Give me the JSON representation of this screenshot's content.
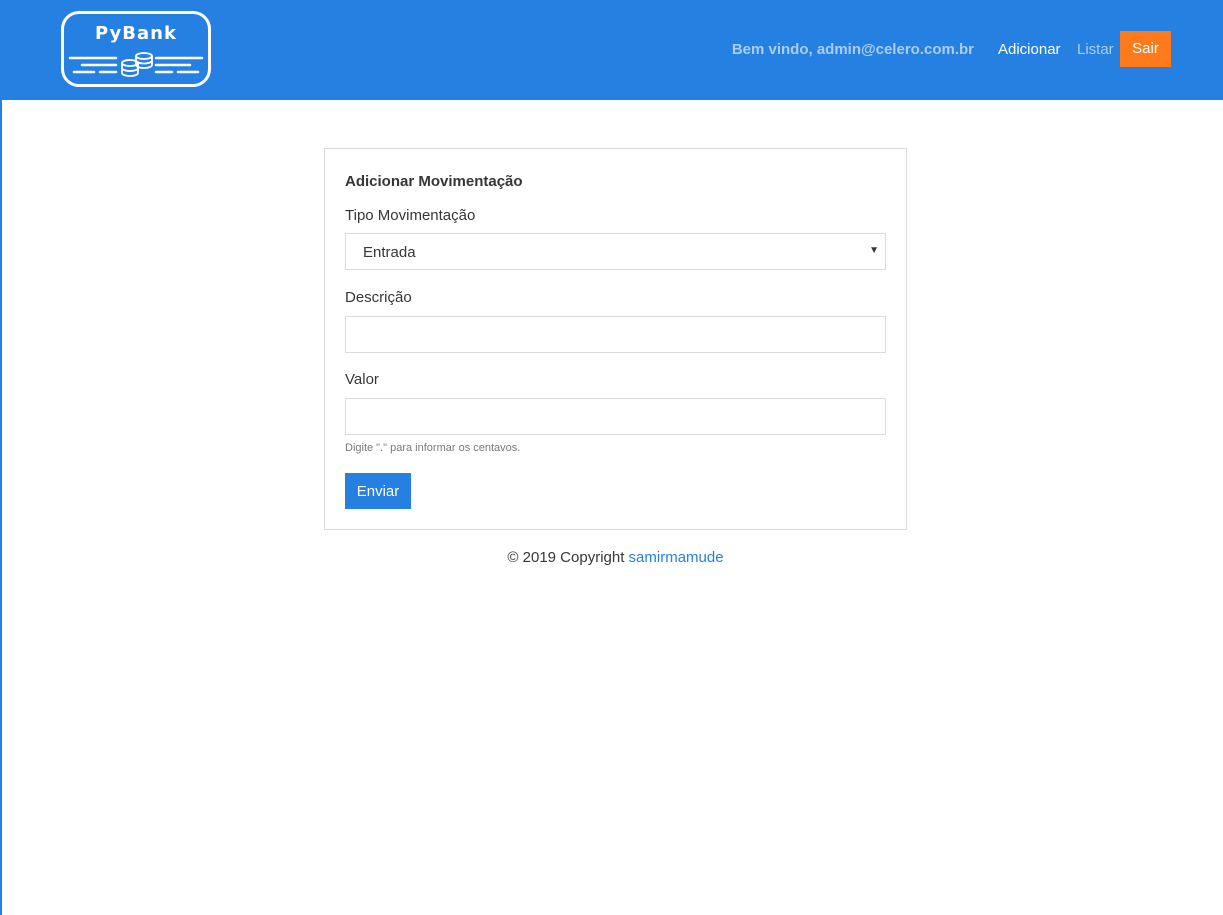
{
  "header": {
    "logo_text": "PyBank",
    "welcome": "Bem vindo, admin@celero.com.br",
    "nav_add": "Adicionar",
    "nav_list": "Listar",
    "logout": "Sair"
  },
  "form": {
    "title": "Adicionar Movimentação",
    "type_label": "Tipo Movimentação",
    "type_selected": "Entrada",
    "description_label": "Descrição",
    "description_value": "",
    "value_label": "Valor",
    "value_value": "",
    "value_help": "Digite \".\" para informar os centavos.",
    "submit": "Enviar"
  },
  "footer": {
    "copyright": "© 2019 Copyright",
    "author": "samirmamude"
  },
  "colors": {
    "primary": "#2680e2",
    "logout": "#ff7a1a",
    "nav_muted": "#a9cdf7"
  }
}
